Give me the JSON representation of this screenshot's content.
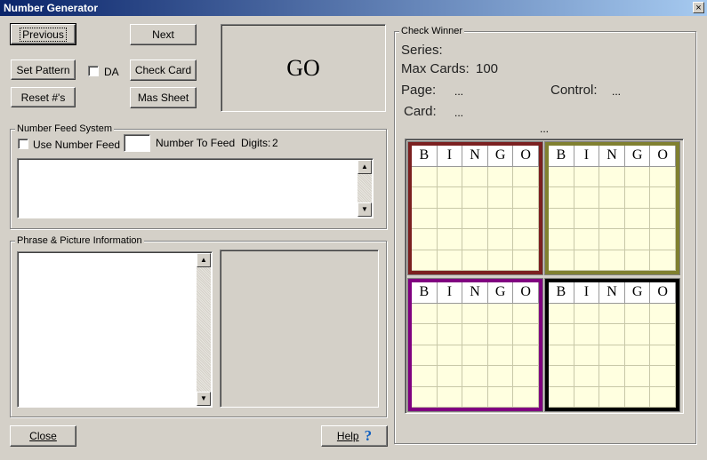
{
  "window": {
    "title": "Number Generator",
    "close_glyph": "×"
  },
  "buttons": {
    "previous": "Previous",
    "next": "Next",
    "set_pattern": "Set Pattern",
    "check_card": "Check Card",
    "reset": "Reset #'s",
    "mas_sheet": "Mas Sheet",
    "close": "Close",
    "help": "Help",
    "go": "GO"
  },
  "da_label": "DA",
  "number_feed": {
    "group_label": "Number Feed System",
    "use_label": "Use Number Feed",
    "number_to_feed_label": "Number To Feed",
    "digits_label": "Digits:",
    "digits_value": "2",
    "number_value": ""
  },
  "phrase": {
    "group_label": "Phrase & Picture Information"
  },
  "check_winner": {
    "group_label": "Check Winner",
    "series_label": "Series:",
    "max_cards_label": "Max Cards:",
    "max_cards_value": "100",
    "page_label": "Page:",
    "page_value": "...",
    "control_label": "Control:",
    "control_value": "...",
    "card_label": "Card:",
    "card_value": "...",
    "extra_value": "..."
  },
  "bingo_letters": [
    "B",
    "I",
    "N",
    "G",
    "O"
  ],
  "bingo_card_colors": [
    "#7b2020",
    "#808030",
    "#800080",
    "#000000"
  ],
  "icons": {
    "help": "question-mark-icon",
    "scroll_up": "▲",
    "scroll_down": "▼"
  }
}
